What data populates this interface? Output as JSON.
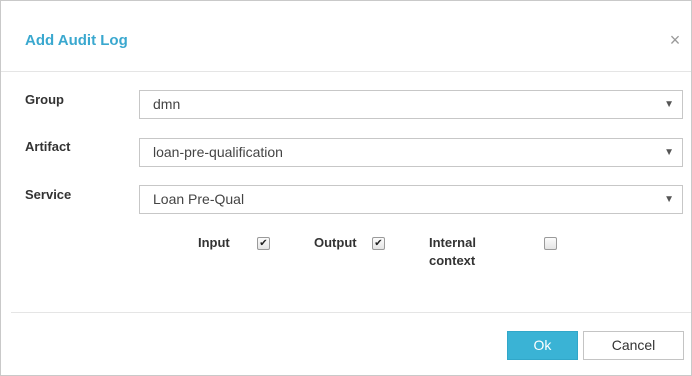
{
  "dialog": {
    "title": "Add Audit Log",
    "close_icon": "close-icon",
    "close_glyph": "×"
  },
  "form": {
    "group": {
      "label": "Group",
      "value": "dmn"
    },
    "artifact": {
      "label": "Artifact",
      "value": "loan-pre-qualification"
    },
    "service": {
      "label": "Service",
      "value": "Loan Pre-Qual"
    },
    "caret_glyph": "▼",
    "checkboxes": [
      {
        "label": "Input",
        "checked": true
      },
      {
        "label": "Output",
        "checked": true
      },
      {
        "label_line1": "Internal",
        "label_line2": "context",
        "checked": false
      }
    ],
    "check_glyph": "✔"
  },
  "buttons": {
    "ok": "Ok",
    "cancel": "Cancel"
  },
  "colors": {
    "accent": "#3aa8cf",
    "ok_button": "#3ab3d5"
  }
}
